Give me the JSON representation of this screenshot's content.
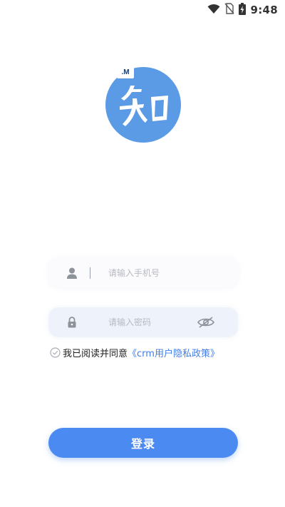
{
  "status_bar": {
    "time": "9:48",
    "icons": [
      "wifi-icon",
      "no-sim-icon",
      "battery-charging-icon"
    ]
  },
  "logo": {
    "tag_text": ".M",
    "glyph_text": "知",
    "color": "#5b9be6"
  },
  "form": {
    "phone": {
      "placeholder": "请输入手机号",
      "value": "",
      "icon": "user-icon"
    },
    "password": {
      "placeholder": "请输入密码",
      "value": "",
      "icon": "lock-icon",
      "toggle_icon": "eye-hidden-icon"
    }
  },
  "agreement": {
    "prefix": "我已阅读并同意",
    "policy_link": "《crm用户隐私政策》",
    "checked": false
  },
  "login_button": {
    "label": "登录",
    "color": "#4b8af0"
  },
  "colors": {
    "accent": "#4b8af0",
    "link": "#3f7ee8"
  }
}
